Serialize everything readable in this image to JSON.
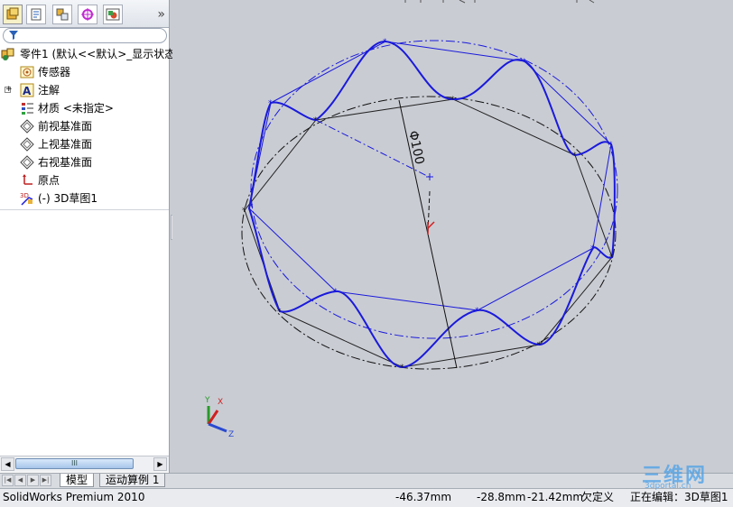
{
  "feature_manager": {
    "tools": [
      {
        "name": "feature-tree-tab"
      },
      {
        "name": "property-manager-tab"
      },
      {
        "name": "configuration-manager-tab"
      },
      {
        "name": "dimxpert-tab"
      },
      {
        "name": "display-manager-tab"
      }
    ],
    "more_symbol": "»",
    "tree": [
      {
        "label": "零件1  (默认<<默认>_显示状态",
        "icon": "part-icon"
      },
      {
        "label": "传感器",
        "icon": "sensor-icon"
      },
      {
        "label": "注解",
        "icon": "annotation-icon"
      },
      {
        "label": "材质 <未指定>",
        "icon": "material-icon"
      },
      {
        "label": "前视基准面",
        "icon": "plane-icon"
      },
      {
        "label": "上视基准面",
        "icon": "plane-icon"
      },
      {
        "label": "右视基准面",
        "icon": "plane-icon"
      },
      {
        "label": "原点",
        "icon": "origin-icon"
      },
      {
        "label": "(-) 3D草图1",
        "icon": "sketch3d-icon"
      }
    ],
    "scrollbar_thumb": "III"
  },
  "graphics": {
    "dimension_text": "Φ100",
    "triad_labels": {
      "x": "X",
      "y": "Y",
      "z": "Z"
    },
    "colors": {
      "sketch_blue": "#1a1adb",
      "sketch_black": "#111111",
      "background": "#c9ccd3"
    }
  },
  "tabs": [
    {
      "label": "模型"
    },
    {
      "label": "运动算例 1"
    }
  ],
  "status_bar": {
    "app": "SolidWorks Premium 2010",
    "x": "-46.37mm",
    "y": "-28.8mm",
    "z": "-21.42mm",
    "state": "欠定义",
    "editing": "正在编辑：3D草图1"
  },
  "watermark": {
    "text": "三维网",
    "sub": "3dportal.cn"
  }
}
